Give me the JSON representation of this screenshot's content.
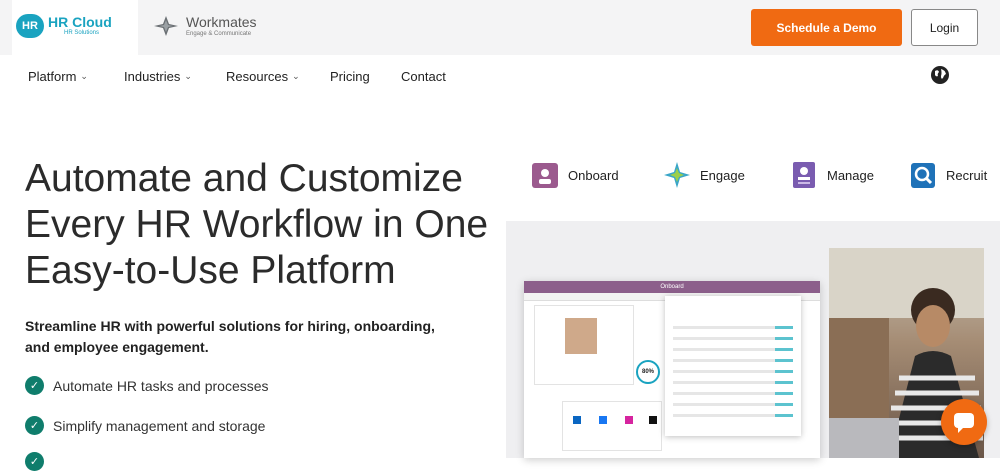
{
  "brands": {
    "hr_cloud": {
      "mark": "HR",
      "name": "HR Cloud",
      "tagline": "HR Solutions"
    },
    "workmates": {
      "name": "Workmates",
      "tagline": "Engage & Communicate"
    }
  },
  "header": {
    "demo_label": "Schedule a Demo",
    "login_label": "Login"
  },
  "nav": {
    "items": [
      {
        "label": "Platform",
        "dropdown": true
      },
      {
        "label": "Industries",
        "dropdown": true
      },
      {
        "label": "Resources",
        "dropdown": true
      },
      {
        "label": "Pricing",
        "dropdown": false
      },
      {
        "label": "Contact",
        "dropdown": false
      }
    ],
    "chevron": "⌄",
    "globe_icon": "globe-icon"
  },
  "hero": {
    "title": "Automate and Customize Every HR Workflow in One Easy-to-Use Platform",
    "subtitle": "Streamline HR with powerful solutions for hiring, onboarding, and employee engagement.",
    "checks": [
      "Automate HR tasks and processes",
      "Simplify management and storage"
    ]
  },
  "products": [
    {
      "label": "Onboard",
      "color": "#9b5a8e"
    },
    {
      "label": "Engage",
      "color": "#3aa6c8"
    },
    {
      "label": "Manage",
      "color": "#7a5cb0"
    },
    {
      "label": "Recruit",
      "color": "#1f72b8"
    }
  ],
  "mockup": {
    "title": "Onboard",
    "percent": "80%"
  },
  "colors": {
    "accent": "#f06a12",
    "brand": "#1aa3c0",
    "check": "#0f7d6c"
  }
}
